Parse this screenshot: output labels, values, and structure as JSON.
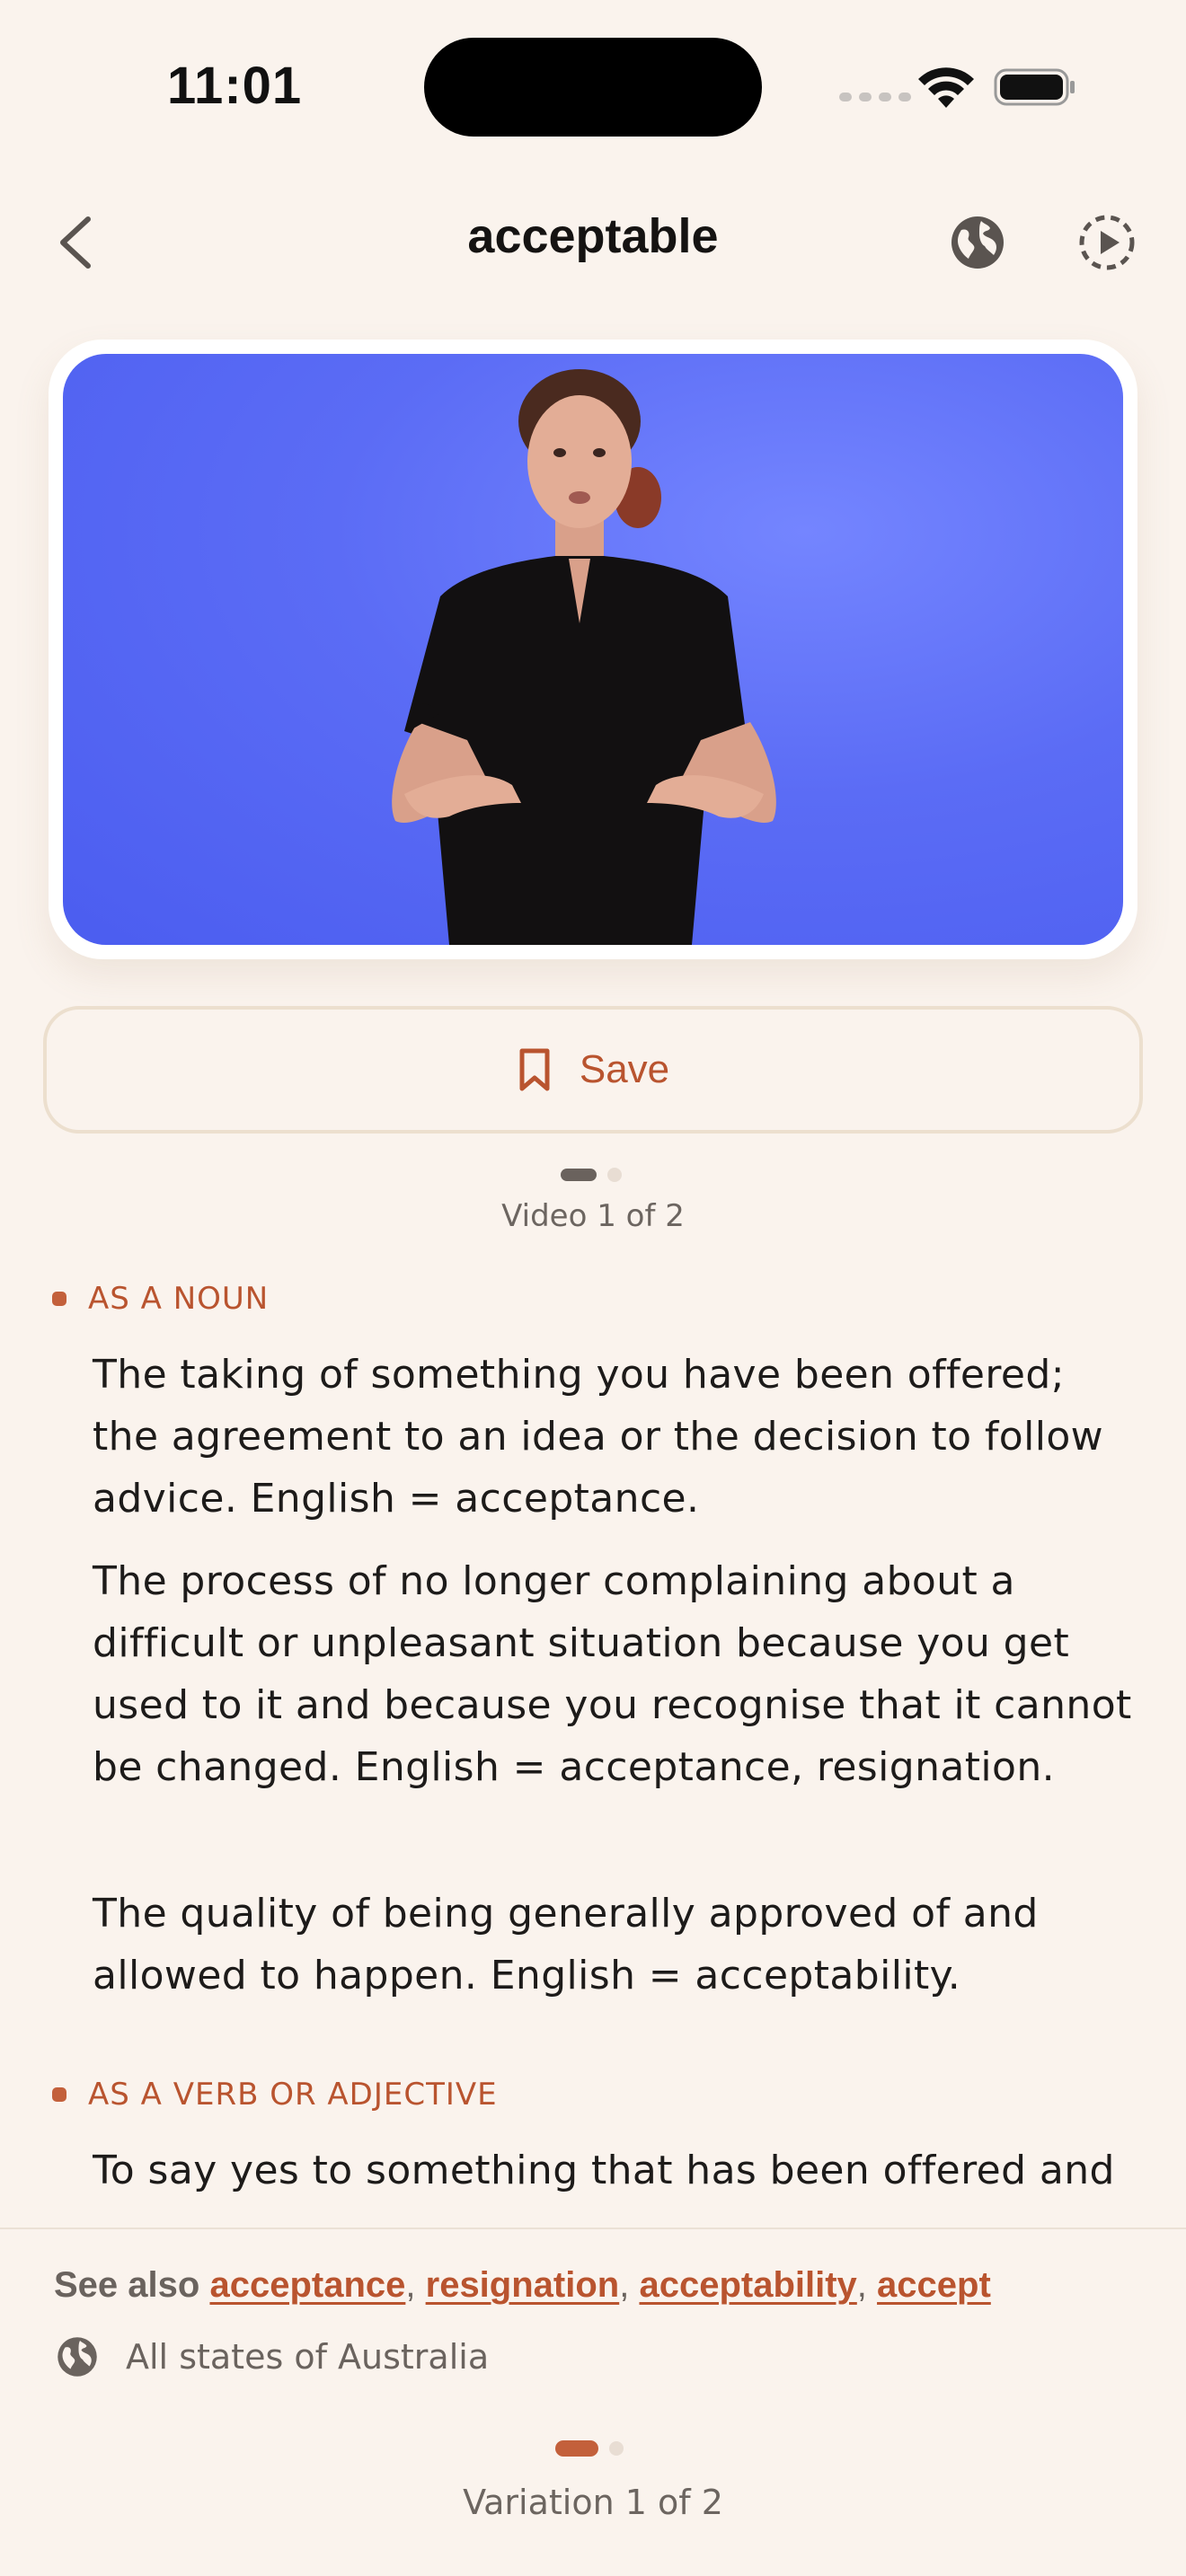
{
  "status_bar": {
    "time": "11:01",
    "icons": [
      "cellular-signal-icon",
      "wifi-icon",
      "battery-icon"
    ]
  },
  "nav": {
    "title": "acceptable",
    "icons": [
      "chevron-left-icon",
      "globe-icon",
      "slow-motion-play-icon"
    ]
  },
  "video": {
    "save_label": "Save",
    "pager_text": "Video 1 of 2",
    "current": 1,
    "total": 2
  },
  "sections": [
    {
      "heading": "AS A NOUN",
      "definitions": [
        "The taking of something you have been offered; the agreement to an idea or the decision to follow advice. English = acceptance.",
        "The process of no longer complaining about a difficult or unpleasant situation because you get used to it and because you recognise that it cannot be changed. English = acceptance, resignation.",
        "The quality of being generally approved of and allowed to happen. English = acceptability."
      ]
    },
    {
      "heading": "AS A VERB OR ADJECTIVE",
      "definitions": [
        "To say yes to something that has been offered and"
      ]
    }
  ],
  "see_also": {
    "label": "See also",
    "links": [
      "acceptance",
      "resignation",
      "acceptability",
      "accept"
    ],
    "separator": ","
  },
  "region": {
    "text": "All states of Australia"
  },
  "variation": {
    "pager_text": "Variation 1 of 2",
    "current": 1,
    "total": 2
  },
  "colors": {
    "background": "#faf3ed",
    "accent": "#b9542f",
    "video_background": "#5b6cf5",
    "text": "#1d1b1a",
    "muted": "#6a635e"
  }
}
